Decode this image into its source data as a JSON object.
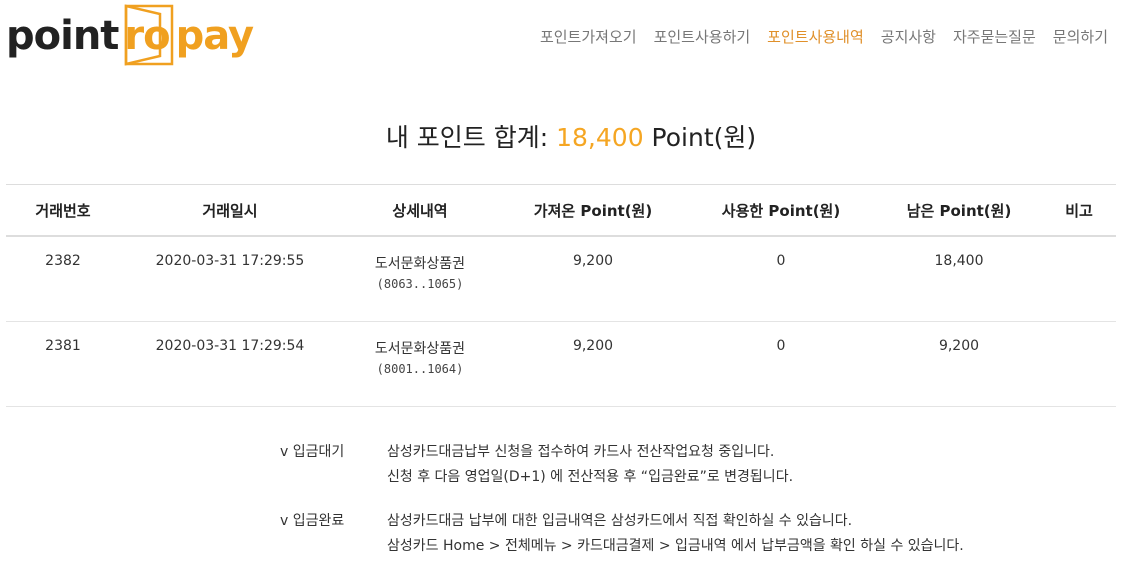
{
  "logo": {
    "part1": "point",
    "part2": "ro",
    "part3": "pay"
  },
  "nav": [
    {
      "label": "포인트가져오기",
      "active": false
    },
    {
      "label": "포인트사용하기",
      "active": false
    },
    {
      "label": "포인트사용내역",
      "active": true
    },
    {
      "label": "공지사항",
      "active": false
    },
    {
      "label": "자주묻는질문",
      "active": false
    },
    {
      "label": "문의하기",
      "active": false
    }
  ],
  "total": {
    "prefix": "내 포인트 합계: ",
    "amount": "18,400",
    "suffix": " Point(원)"
  },
  "table": {
    "headers": [
      "거래번호",
      "거래일시",
      "상세내역",
      "가져온 Point(원)",
      "사용한 Point(원)",
      "남은 Point(원)",
      "비고"
    ],
    "rows": [
      {
        "id": "2382",
        "datetime": "2020-03-31 17:29:55",
        "detail": "도서문화상품권",
        "code": "(8063..1065)",
        "imported": "9,200",
        "used": "0",
        "remaining": "18,400",
        "note": ""
      },
      {
        "id": "2381",
        "datetime": "2020-03-31 17:29:54",
        "detail": "도서문화상품권",
        "code": "(8001..1064)",
        "imported": "9,200",
        "used": "0",
        "remaining": "9,200",
        "note": ""
      }
    ]
  },
  "notes": [
    {
      "label": "v 입금대기",
      "lines": [
        "삼성카드대금납부 신청을 접수하여 카드사 전산작업요청 중입니다.",
        "신청 후 다음 영업일(D+1) 에 전산적용 후 “입금완료”로 변경됩니다."
      ]
    },
    {
      "label": "v 입금완료",
      "lines": [
        "삼성카드대금 납부에 대한 입금내역은 삼성카드에서 직접 확인하실 수 있습니다.",
        "삼성카드 Home > 전체메뉴 > 카드대금결제 > 입금내역 에서 납부금액을 확인 하실 수 있습니다."
      ]
    }
  ],
  "colors": {
    "accent": "#f5a623",
    "nav_active": "#e0902a",
    "nav": "#777777"
  }
}
